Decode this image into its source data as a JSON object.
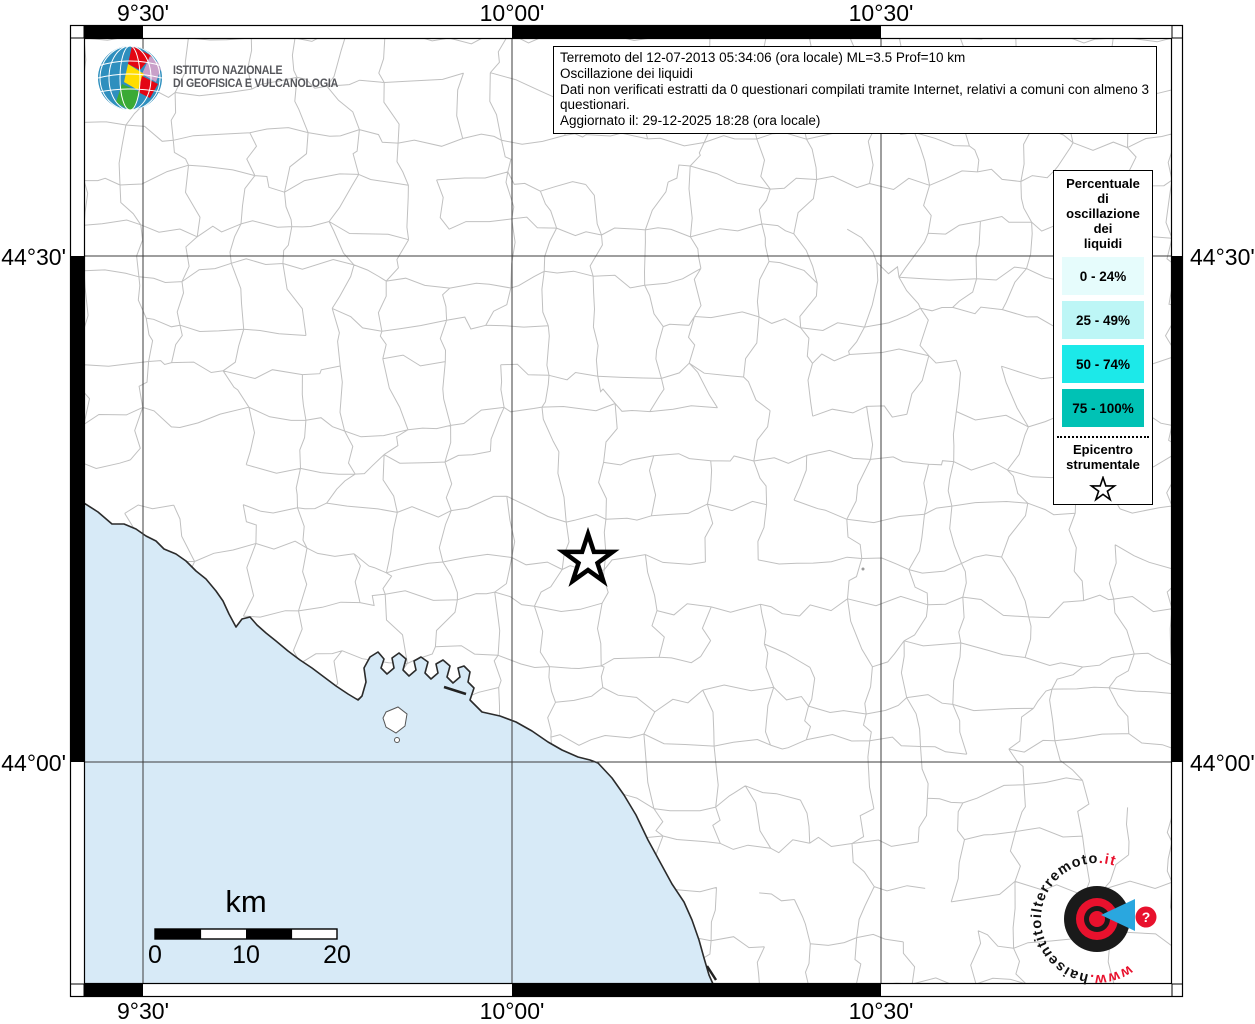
{
  "info_box": {
    "line1": "Terremoto del 12-07-2013 05:34:06 (ora locale) ML=3.5 Prof=10 km",
    "line2": "Oscillazione dei liquidi",
    "line3": "Dati non verificati estratti da 0 questionari compilati tramite Internet, relativi a comuni con almeno 3 questionari.",
    "line4": "Aggiornato il: 29-12-2025 18:28 (ora locale)"
  },
  "ingv": {
    "name_line1": "ISTITUTO NAZIONALE",
    "name_line2": "DI GEOFISICA E VULCANOLOGIA"
  },
  "legend": {
    "title_lines": [
      "Percentuale",
      "di",
      "oscillazione",
      "dei",
      "liquidi"
    ],
    "classes": [
      {
        "label": "0 - 24%",
        "color": "#e6fcfc"
      },
      {
        "label": "25 - 49%",
        "color": "#bdf6f6"
      },
      {
        "label": "50 - 74%",
        "color": "#1ce9e9"
      },
      {
        "label": "75 - 100%",
        "color": "#00c2b5"
      }
    ],
    "epicenter_line1": "Epicentro",
    "epicenter_line2": "strumentale"
  },
  "axis": {
    "lon": [
      "9°30'",
      "10°00'",
      "10°30'"
    ],
    "lat": [
      "44°30'",
      "44°00'"
    ]
  },
  "scalebar": {
    "unit": "km",
    "tick0": "0",
    "tick1": "10",
    "tick2": "20"
  },
  "watermark": {
    "www": "www.",
    "domain": "haisentitoilterremoto",
    "tld": ".it",
    "badge": "?"
  },
  "colors": {
    "sea": "#d7eaf7",
    "boundary": "#c0c0c0",
    "coast": "#2b2b2b",
    "red": "#e8112d",
    "blue_cone": "#2aa7df"
  }
}
